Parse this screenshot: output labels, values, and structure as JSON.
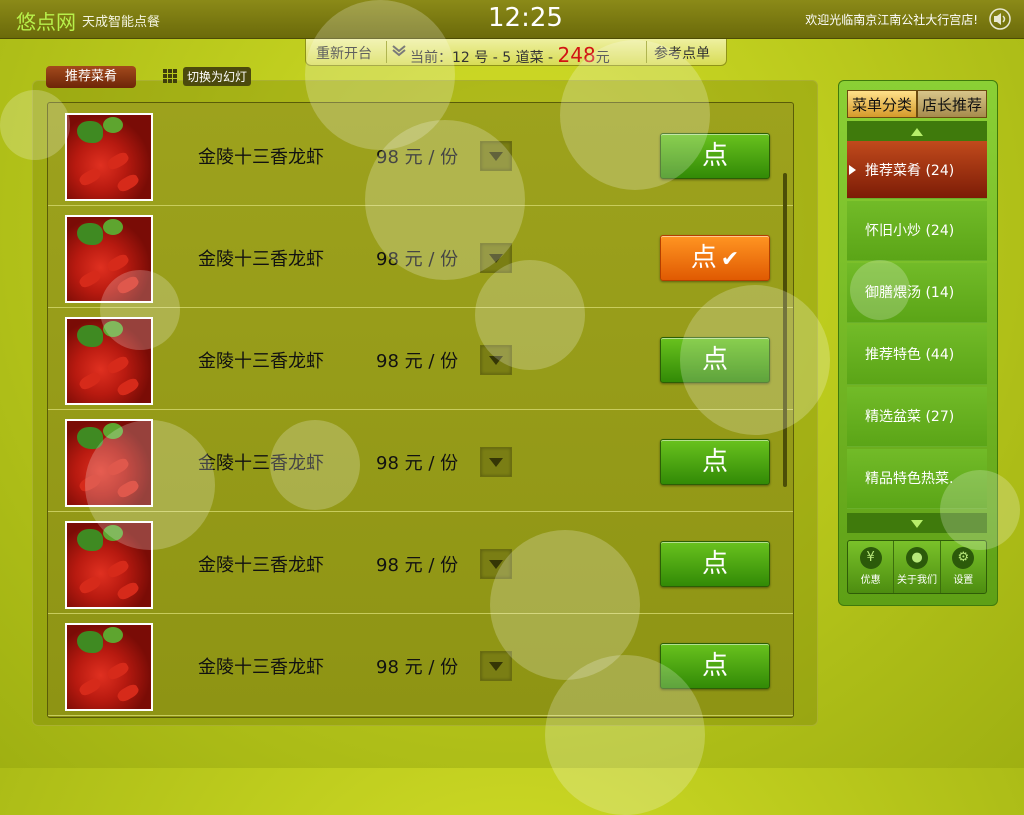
{
  "header": {
    "logo": "悠点网",
    "slogan": "天成智能点餐",
    "time": "12:25",
    "welcome": "欢迎光临南京江南公社大行宫店!",
    "speaker_icon": "speaker-icon"
  },
  "order_bar": {
    "reset_label": "重新开台",
    "status_prefix": "当前：12 号 - 5 道菜 -",
    "total": "248",
    "currency": "元",
    "reference_label": "参考点单"
  },
  "tabs": {
    "recommended": "推荐菜肴",
    "switch_slideshow": "切换为幻灯"
  },
  "dishes": [
    {
      "name": "金陵十三香龙虾",
      "price": "98 元 / 份",
      "button": "点",
      "ordered": false
    },
    {
      "name": "金陵十三香龙虾",
      "price": "98 元 / 份",
      "button": "点",
      "ordered": true
    },
    {
      "name": "金陵十三香龙虾",
      "price": "98 元 / 份",
      "button": "点",
      "ordered": false
    },
    {
      "name": "金陵十三香龙虾",
      "price": "98 元 / 份",
      "button": "点",
      "ordered": false
    },
    {
      "name": "金陵十三香龙虾",
      "price": "98 元 / 份",
      "button": "点",
      "ordered": false
    },
    {
      "name": "金陵十三香龙虾",
      "price": "98 元 / 份",
      "button": "点",
      "ordered": false
    }
  ],
  "sidebar": {
    "tab_menu": "菜单分类",
    "tab_chef": "店长推荐",
    "categories": [
      {
        "label": "推荐菜肴 (24)",
        "active": true
      },
      {
        "label": "怀旧小炒 (24)",
        "active": false
      },
      {
        "label": "御膳煨汤 (14)",
        "active": false
      },
      {
        "label": "推荐特色 (44)",
        "active": false
      },
      {
        "label": "精选盆菜 (27)",
        "active": false
      },
      {
        "label": "精品特色热菜.",
        "active": false
      }
    ],
    "tools": [
      {
        "label": "优惠",
        "icon": "yen-icon",
        "glyph": "¥"
      },
      {
        "label": "关于我们",
        "icon": "user-icon",
        "glyph": "●"
      },
      {
        "label": "设置",
        "icon": "gear-icon",
        "glyph": "⚙"
      }
    ]
  },
  "colors": {
    "background": "#bccb1d",
    "topbar": "#7a7910",
    "order_button": "#4aa812",
    "ordered_button": "#f07010",
    "price_red": "#d11414",
    "active_category": "#a0360f"
  }
}
